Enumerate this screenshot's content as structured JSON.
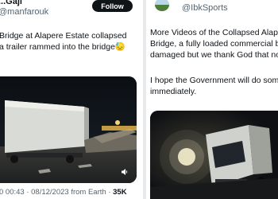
{
  "left_tweet": {
    "name": "...Gaji",
    "handle": "@manfarouk",
    "follow_label": "Follow",
    "more_icon": "more-dots-icon",
    "text_lines": [
      "Bridge at Alapere Estate collapsed",
      "a trailer rammed into the bridge😓"
    ],
    "timestamp": "0 00:43 · 08/12/2023",
    "source": "from Earth ·",
    "views": "35K",
    "volume_icon": "speaker-icon"
  },
  "right_tweet": {
    "handle": "@IbkSports",
    "avatar_icon": "avatar-icon",
    "text_lines": [
      "More Videos of the Collapsed Alape",
      "Bridge, a fully loaded commercial b",
      "damaged but we thank God that no"
    ],
    "text_lines_2": [
      "I hope the Government will do som",
      "immediately."
    ]
  },
  "colors": {
    "text": "#0f1419",
    "secondary": "#536471",
    "follow_bg": "#0f1419",
    "background": "#ffffff"
  }
}
